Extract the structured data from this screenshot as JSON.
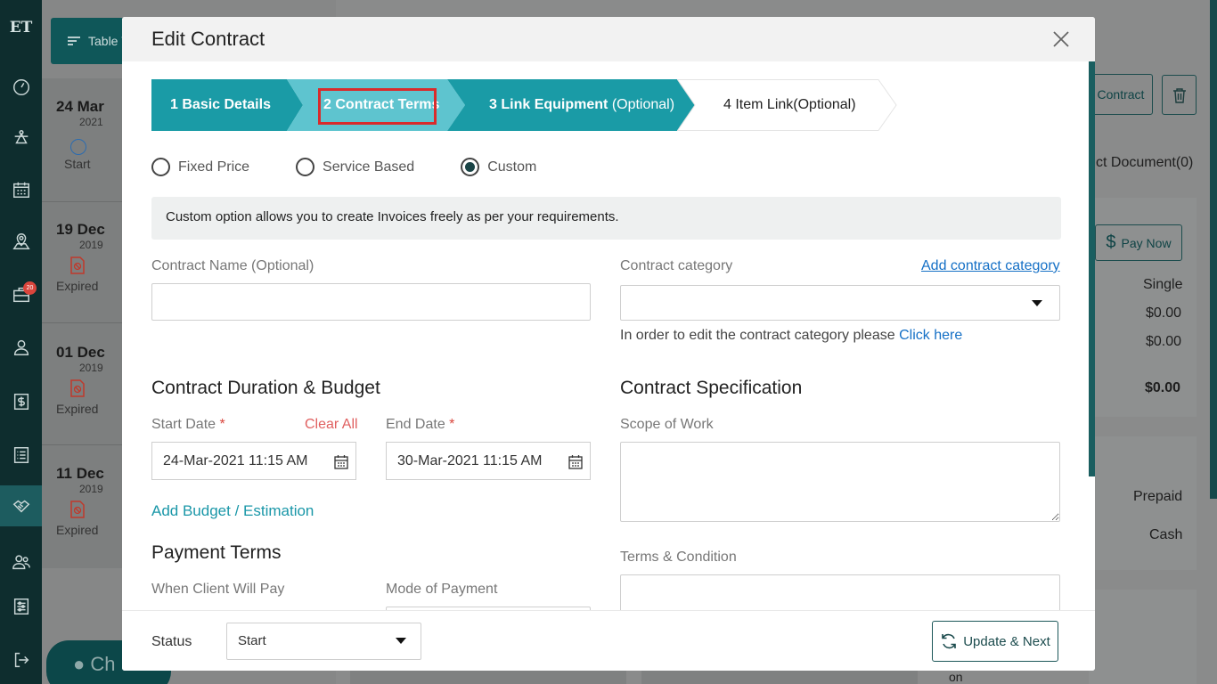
{
  "rail": {
    "logo": "ET",
    "badge_count": "20"
  },
  "background": {
    "tableview_label": "Table V",
    "timeline": [
      {
        "day": "24 Mar",
        "year": "2021",
        "status": "Start"
      },
      {
        "day": "19 Dec",
        "year": "2019",
        "status": "Expired"
      },
      {
        "day": "01 Dec",
        "year": "2019",
        "status": "Expired"
      },
      {
        "day": "11 Dec",
        "year": "2019",
        "status": "Expired"
      }
    ],
    "chat_label": "Ch",
    "right_panel": {
      "contract_btn": "Contract",
      "documents_tab": "ct Document(0)",
      "pay_now": "Pay Now",
      "single": "Single",
      "amount1": "$0.00",
      "amount2": "$0.00",
      "total": "$0.00",
      "prepaid": "Prepaid",
      "cash": "Cash",
      "on": "on"
    }
  },
  "modal": {
    "title": "Edit Contract",
    "steps": [
      {
        "number": "1",
        "label": "Basic Details",
        "suffix": ""
      },
      {
        "number": "2",
        "label": "Contract Terms",
        "suffix": ""
      },
      {
        "number": "3",
        "label": "Link Equipment",
        "suffix": "(Optional)"
      },
      {
        "number": "4",
        "label": "Item Link(Optional)",
        "suffix": ""
      }
    ],
    "pricing_options": [
      "Fixed Price",
      "Service Based",
      "Custom"
    ],
    "selected_pricing": "Custom",
    "info_text": "Custom option allows you to create Invoices freely as per your requirements.",
    "contract_name_label": "Contract Name (Optional)",
    "contract_name_value": "",
    "contract_category_label": "Contract category",
    "add_category_link": "Add contract category",
    "category_value": "",
    "category_help": "In order to edit the contract category please",
    "category_help_link": "Click here",
    "duration_title": "Contract Duration & Budget",
    "start_date_label": "Start Date",
    "end_date_label": "End Date",
    "required_mark": "*",
    "clear_all": "Clear All",
    "start_date_value": "24-Mar-2021 11:15 AM",
    "end_date_value": "30-Mar-2021 11:15 AM",
    "add_budget": "Add Budget / Estimation",
    "payment_title": "Payment Terms",
    "when_pay_label": "When Client Will Pay",
    "mode_payment_label": "Mode of Payment",
    "spec_title": "Contract Specification",
    "scope_label": "Scope of Work",
    "scope_value": "",
    "terms_label": "Terms & Condition",
    "status_label": "Status",
    "status_value": "Start",
    "update_next": "Update & Next"
  },
  "colors": {
    "step_active": "#1a9ba6",
    "step_current": "#5ec4cf",
    "rail": "#0e2d2e",
    "accent": "#1a5e60",
    "highlight_outline": "#d92b2b"
  }
}
